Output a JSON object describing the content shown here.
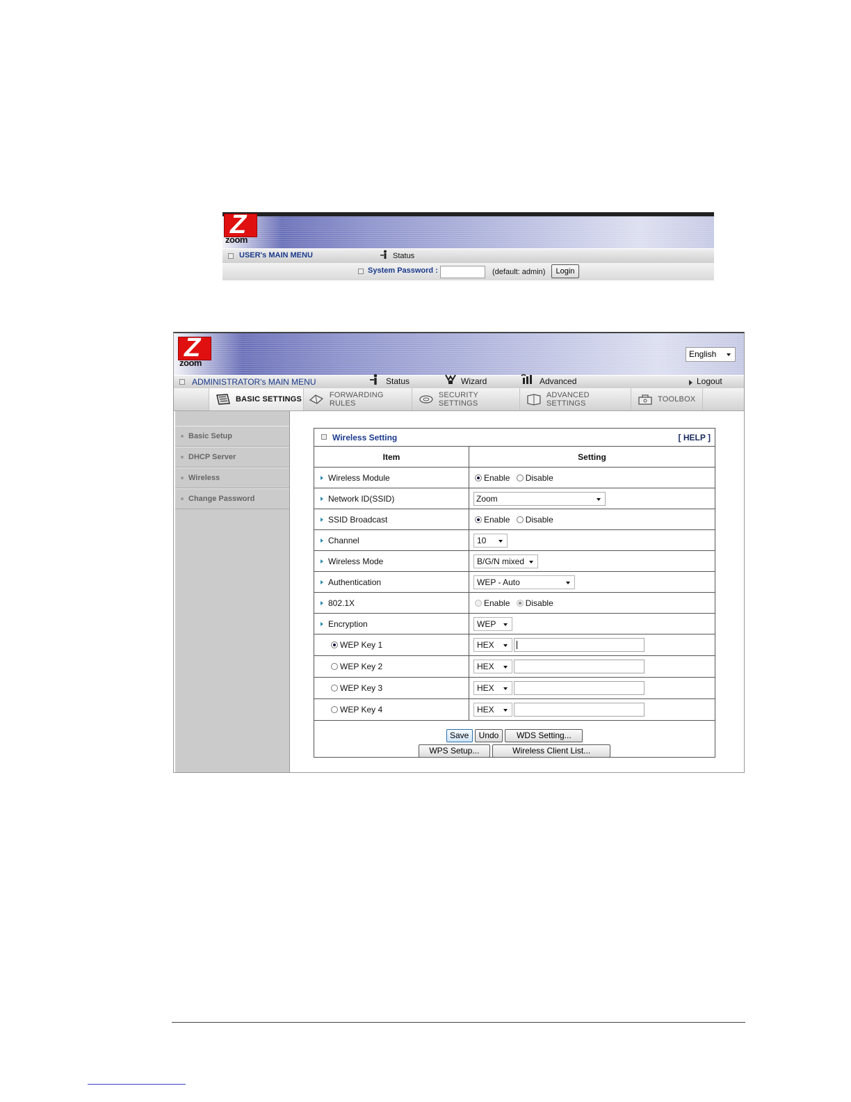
{
  "user_menu": {
    "brand": "zoom",
    "menu_title": "USER's MAIN MENU",
    "status_label": "Status",
    "password_label": "System Password :",
    "password_value": "",
    "default_hint": "(default: admin)",
    "login_label": "Login"
  },
  "admin": {
    "brand": "zoom",
    "language": "English",
    "menu_title": "ADMINISTRATOR's MAIN MENU",
    "nav": {
      "status": "Status",
      "wizard": "Wizard",
      "advanced": "Advanced",
      "logout": "Logout"
    },
    "tabs": [
      {
        "label": "BASIC SETTINGS"
      },
      {
        "label": "FORWARDING RULES"
      },
      {
        "label": "SECURITY SETTINGS"
      },
      {
        "label": "ADVANCED SETTINGS"
      },
      {
        "label": "TOOLBOX"
      }
    ],
    "sidebar": [
      {
        "label": "Basic Setup"
      },
      {
        "label": "DHCP Server"
      },
      {
        "label": "Wireless"
      },
      {
        "label": "Change Password"
      }
    ],
    "panel": {
      "title": "Wireless Setting",
      "help": "[ HELP ]",
      "col_item": "Item",
      "col_setting": "Setting",
      "enable": "Enable",
      "disable": "Disable",
      "rows": {
        "wireless_module": "Wireless Module",
        "ssid": "Network ID(SSID)",
        "ssid_value": "Zoom",
        "ssid_broadcast": "SSID Broadcast",
        "channel": "Channel",
        "channel_value": "10",
        "wireless_mode": "Wireless Mode",
        "wireless_mode_value": "B/G/N mixed",
        "authentication": "Authentication",
        "authentication_value": "WEP - Auto",
        "dot1x": "802.1X",
        "encryption": "Encryption",
        "encryption_value": "WEP"
      },
      "wep_keys": [
        {
          "label": "WEP Key 1",
          "format": "HEX",
          "value": "",
          "selected": true
        },
        {
          "label": "WEP Key 2",
          "format": "HEX",
          "value": "",
          "selected": false
        },
        {
          "label": "WEP Key 3",
          "format": "HEX",
          "value": "",
          "selected": false
        },
        {
          "label": "WEP Key 4",
          "format": "HEX",
          "value": "",
          "selected": false
        }
      ],
      "buttons": {
        "save": "Save",
        "undo": "Undo",
        "wds": "WDS Setting...",
        "wps": "WPS Setup...",
        "client_list": "Wireless Client List..."
      }
    }
  }
}
